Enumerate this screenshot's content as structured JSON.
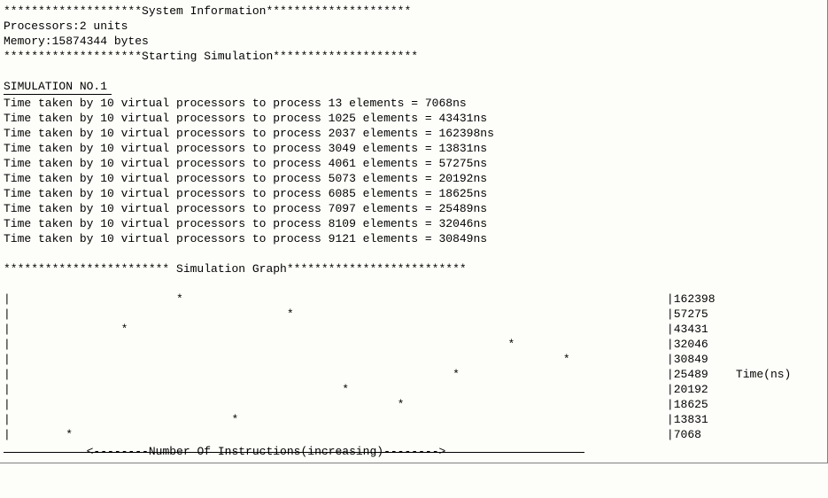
{
  "chart_data": {
    "type": "bar",
    "categories": [
      13,
      1025,
      2037,
      3049,
      4061,
      5073,
      6085,
      7097,
      8109,
      9121
    ],
    "values": [
      7068,
      43431,
      162398,
      13831,
      57275,
      20192,
      18625,
      25489,
      32046,
      30849
    ],
    "title": "Simulation Graph",
    "xlabel": "Number Of Instructions(increasing)",
    "ylabel": "Time(ns)",
    "ylim": [
      0,
      162398
    ]
  },
  "header": {
    "system_info": "********************System Information*********************",
    "processors_label": "Processors:",
    "processors_value": "2 units",
    "memory_label": "Memory:",
    "memory_value": "15874344 bytes",
    "starting": "********************Starting Simulation*********************"
  },
  "simulation": {
    "title": "SIMULATION NO.1",
    "line_prefix": "Time taken by ",
    "vp_count": "10",
    "line_mid": " virtual processors to process ",
    "line_suffix": " elements = ",
    "unit": "ns",
    "entries": [
      {
        "elements": "13",
        "time": "7068"
      },
      {
        "elements": "1025",
        "time": "43431"
      },
      {
        "elements": "2037",
        "time": "162398"
      },
      {
        "elements": "3049",
        "time": "13831"
      },
      {
        "elements": "4061",
        "time": "57275"
      },
      {
        "elements": "5073",
        "time": "20192"
      },
      {
        "elements": "6085",
        "time": "18625"
      },
      {
        "elements": "7097",
        "time": "25489"
      },
      {
        "elements": "8109",
        "time": "32046"
      },
      {
        "elements": "9121",
        "time": "30849"
      }
    ]
  },
  "graph": {
    "title": "************************ Simulation Graph**************************",
    "ylabel": "Time(ns)",
    "xlabel": "<--------Number Of Instructions(increasing)-------->",
    "sorted_values": [
      162398,
      57275,
      43431,
      32046,
      30849,
      25489,
      20192,
      18625,
      13831,
      7068
    ],
    "bar_offsets": [
      24,
      40,
      16,
      72,
      80,
      64,
      48,
      56,
      32,
      8
    ]
  }
}
